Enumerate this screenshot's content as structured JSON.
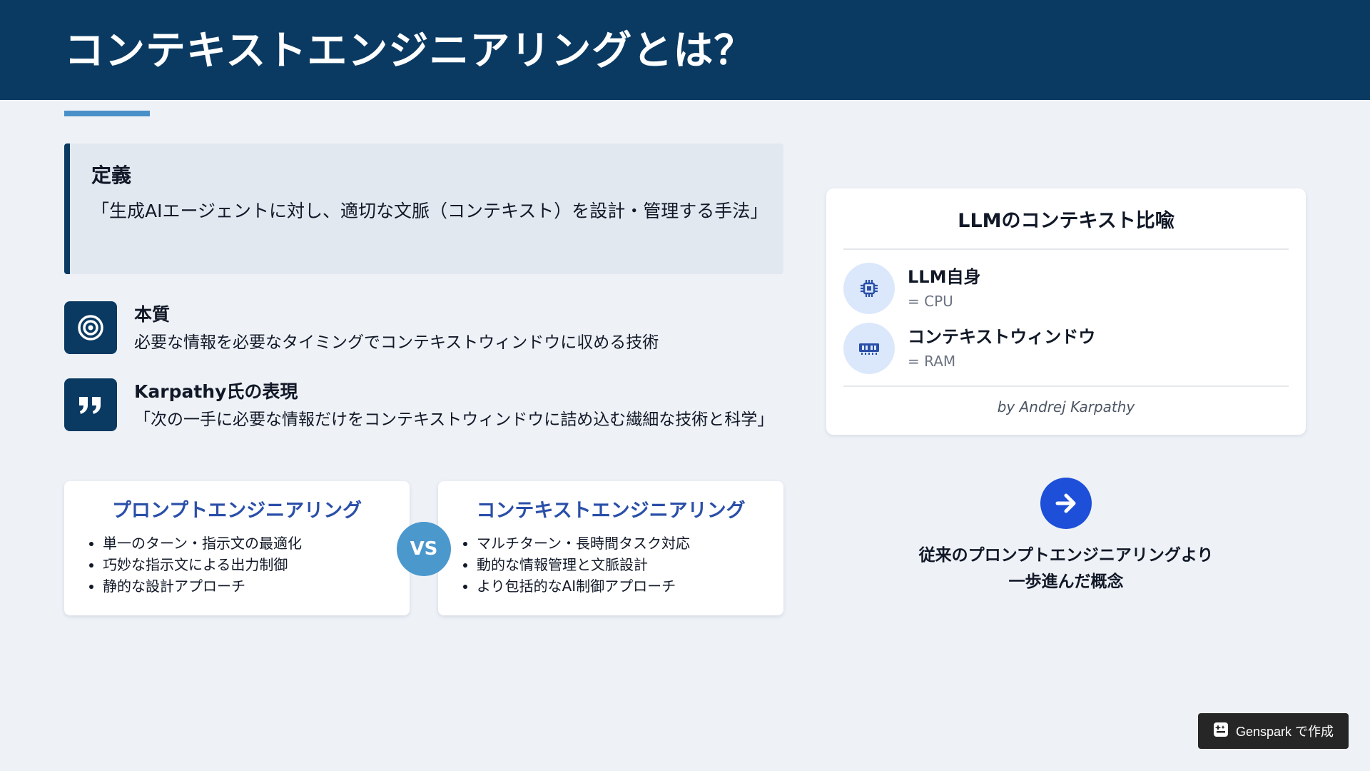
{
  "header": {
    "title": "コンテキストエンジニアリングとは？"
  },
  "definition": {
    "title": "定義",
    "text": "「生成AIエージェントに対し、適切な文脈（コンテキスト）を設計・管理する手法」"
  },
  "features": [
    {
      "icon": "target-icon",
      "title": "本質",
      "text": "必要な情報を必要なタイミングでコンテキストウィンドウに収める技術"
    },
    {
      "icon": "quote-icon",
      "title": "Karpathy氏の表現",
      "text": "「次の一手に必要な情報だけをコンテキストウィンドウに詰め込む繊細な技術と科学」"
    }
  ],
  "comparison": {
    "left": {
      "title": "プロンプトエンジニアリング",
      "items": [
        "単一のターン・指示文の最適化",
        "巧妙な指示文による出力制御",
        "静的な設計アプローチ"
      ]
    },
    "vs_label": "VS",
    "right": {
      "title": "コンテキストエンジニアリング",
      "items": [
        "マルチターン・長時間タスク対応",
        "動的な情報管理と文脈設計",
        "より包括的なAI制御アプローチ"
      ]
    }
  },
  "llm_card": {
    "title": "LLMのコンテキスト比喩",
    "rows": [
      {
        "icon": "cpu-chip-icon",
        "title": "LLM自身",
        "sub": "= CPU"
      },
      {
        "icon": "memory-icon",
        "title": "コンテキストウィンドウ",
        "sub": "= RAM"
      }
    ],
    "attribution": "by Andrej Karpathy"
  },
  "summary": {
    "icon": "arrow-right-icon",
    "line1": "従来のプロンプトエンジニアリングより",
    "line2": "一歩進んだ概念"
  },
  "badge": {
    "label": "Genspark で作成",
    "icon": "genspark-icon"
  },
  "colors": {
    "header_bg": "#0a3a62",
    "page_bg": "#eef2f7",
    "accent": "#4a90c8",
    "compare_title": "#2a4fa8",
    "vs_badge": "#4b98cd",
    "arrow_circle": "#1d4fd8",
    "icon_circle": "#dbe8fb"
  }
}
